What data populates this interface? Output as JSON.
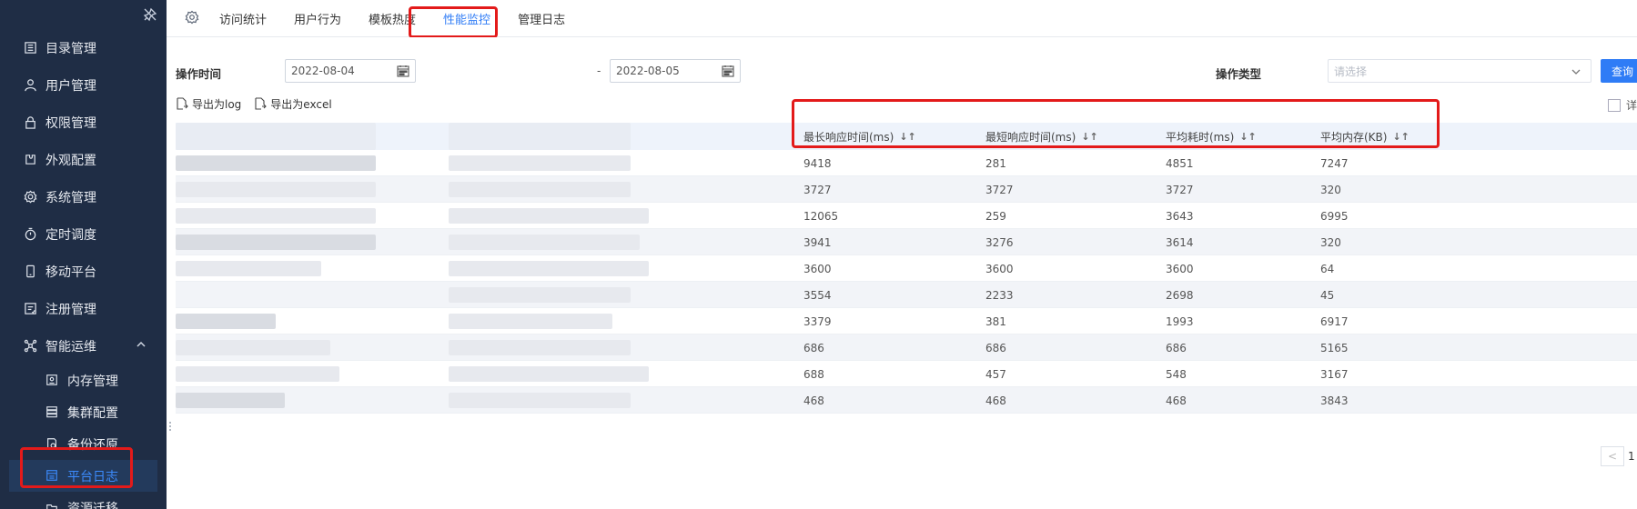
{
  "sidebar": {
    "items": [
      {
        "label": "目录管理",
        "icon": "catalog-icon"
      },
      {
        "label": "用户管理",
        "icon": "user-icon"
      },
      {
        "label": "权限管理",
        "icon": "lock-icon"
      },
      {
        "label": "外观配置",
        "icon": "puzzle-icon"
      },
      {
        "label": "系统管理",
        "icon": "gear-icon"
      },
      {
        "label": "定时调度",
        "icon": "clock-icon"
      },
      {
        "label": "移动平台",
        "icon": "mobile-icon"
      },
      {
        "label": "注册管理",
        "icon": "register-icon"
      },
      {
        "label": "智能运维",
        "icon": "ops-icon"
      }
    ],
    "sub_items": [
      {
        "label": "内存管理",
        "icon": "memory-icon"
      },
      {
        "label": "集群配置",
        "icon": "cluster-icon"
      },
      {
        "label": "备份还原",
        "icon": "backup-icon"
      },
      {
        "label": "平台日志",
        "icon": "log-icon",
        "active": true
      },
      {
        "label": "资源迁移",
        "icon": "migrate-icon"
      }
    ]
  },
  "tabs": [
    {
      "label": "访问统计"
    },
    {
      "label": "用户行为"
    },
    {
      "label": "模板热度"
    },
    {
      "label": "性能监控",
      "active": true
    },
    {
      "label": "管理日志"
    }
  ],
  "filter": {
    "time_label": "操作时间",
    "date_from": "2022-08-04",
    "date_sep": "-",
    "date_to": "2022-08-05",
    "type_label": "操作类型",
    "type_placeholder": "请选择",
    "query_button": "查询"
  },
  "exports": {
    "log": "导出为log",
    "excel": "导出为excel",
    "detail": "详"
  },
  "table": {
    "headers": [
      "最长响应时间(ms)",
      "最短响应时间(ms)",
      "平均耗时(ms)",
      "平均内存(KB)"
    ],
    "sort_glyph": "↓↑",
    "rows": [
      [
        "9418",
        "281",
        "4851",
        "7247"
      ],
      [
        "3727",
        "3727",
        "3727",
        "320"
      ],
      [
        "12065",
        "259",
        "3643",
        "6995"
      ],
      [
        "3941",
        "3276",
        "3614",
        "320"
      ],
      [
        "3600",
        "3600",
        "3600",
        "64"
      ],
      [
        "3554",
        "2233",
        "2698",
        "45"
      ],
      [
        "3379",
        "381",
        "1993",
        "6917"
      ],
      [
        "686",
        "686",
        "686",
        "5165"
      ],
      [
        "688",
        "457",
        "548",
        "3167"
      ],
      [
        "468",
        "468",
        "468",
        "3843"
      ]
    ]
  },
  "pager": {
    "prev": "<",
    "page": "1"
  },
  "colors": {
    "sidebar_bg": "#1f2d45",
    "accent": "#2f7cf6",
    "highlight_box": "#e31a1a"
  }
}
